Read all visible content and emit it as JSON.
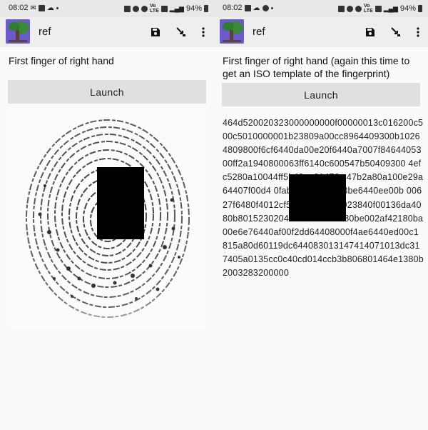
{
  "colors": {
    "status_bar": "#e8e8e8",
    "app_bar": "#eeeeee",
    "button": "#e0e0e0",
    "redaction": "#000000",
    "app_icon_bg": "#5c6bc0"
  },
  "left_screen": {
    "status_bar": {
      "time": "08:02",
      "battery": "94%"
    },
    "app_bar": {
      "title": "ref",
      "icons": [
        "app-logo-icon",
        "save-icon",
        "fingerprint-pointer-icon",
        "more-vert-icon"
      ]
    },
    "instruction": "First finger of right hand",
    "launch_label": "Launch",
    "image": "fingerprint-image"
  },
  "right_screen": {
    "status_bar": {
      "time": "08:02",
      "battery": "94%"
    },
    "app_bar": {
      "title": "ref",
      "icons": [
        "app-logo-icon",
        "save-icon",
        "fingerprint-pointer-icon",
        "more-vert-icon"
      ]
    },
    "instruction": "First finger of right hand (again this time to get an ISO template of the fingerprint)",
    "launch_label": "Launch",
    "iso_template_hex": "464d520020323000000000f00000013c016200c500c5010000001b23809a00cc8964409300b10264809800f6cf6440da00e20f6440a7007f8464405300ff2a1940800063ff6140c600547b50409300 4efc5280a10044ff5b40ea01476c 47b2a80a100e29a64407f00d4 0fabb64408b0103be6440ee00b 00627f6480f4012cf54d804e0071923840f00136da4080b801523020409c0036043c80be002af42180ba00e6e76440af00f2dd64408000f4ae6440ed00c1815a80d60119dc644083013147414071013dc317405a0135cc0c40cd014ccb3b806801464e1380b2003283200000"
  }
}
